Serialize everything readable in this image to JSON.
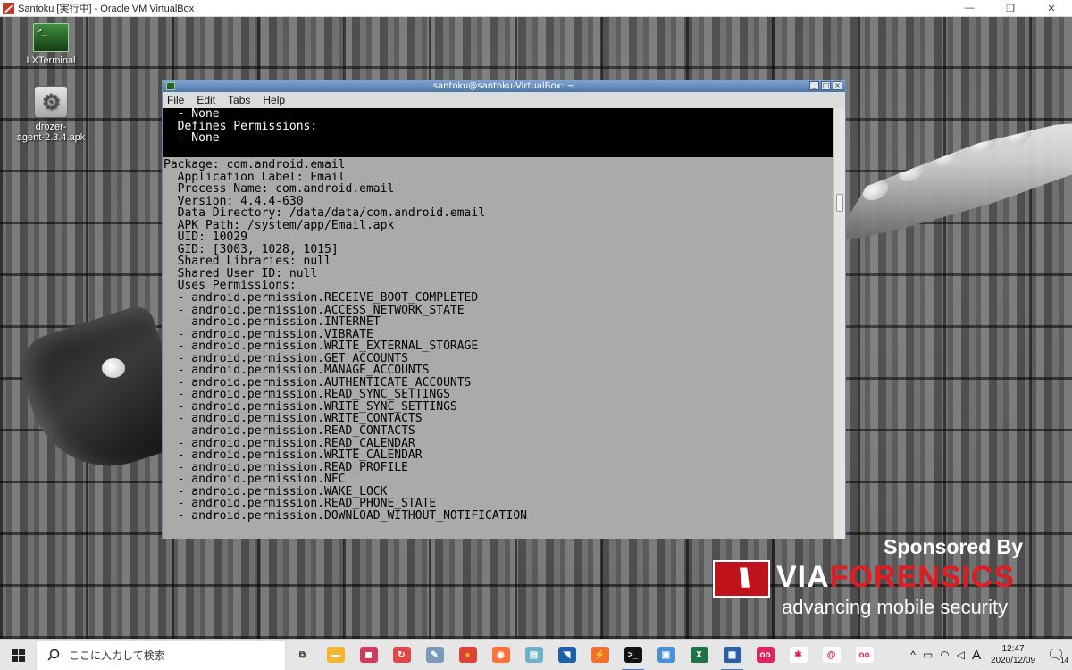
{
  "host_window": {
    "title": "Santoku [実行中] - Oracle VM VirtualBox",
    "minimize": "—",
    "restore": "❐",
    "close": "✕"
  },
  "desktop": {
    "icons": [
      {
        "label": "LXTerminal",
        "glyph": ">_"
      },
      {
        "label": "drozer-\nagent-2.3.4.apk",
        "glyph": "⚙"
      }
    ]
  },
  "terminal": {
    "title": "santoku@santoku-VirtualBox: ~",
    "menu": [
      "File",
      "Edit",
      "Tabs",
      "Help"
    ],
    "black_lines": [
      "  - None",
      "  Defines Permissions:",
      "  - None"
    ],
    "grey_lines": [
      "Package: com.android.email",
      "  Application Label: Email",
      "  Process Name: com.android.email",
      "  Version: 4.4.4-630",
      "  Data Directory: /data/data/com.android.email",
      "  APK Path: /system/app/Email.apk",
      "  UID: 10029",
      "  GID: [3003, 1028, 1015]",
      "  Shared Libraries: null",
      "  Shared User ID: null",
      "  Uses Permissions:",
      "  - android.permission.RECEIVE_BOOT_COMPLETED",
      "  - android.permission.ACCESS_NETWORK_STATE",
      "  - android.permission.INTERNET",
      "  - android.permission.VIBRATE",
      "  - android.permission.WRITE_EXTERNAL_STORAGE",
      "  - android.permission.GET_ACCOUNTS",
      "  - android.permission.MANAGE_ACCOUNTS",
      "  - android.permission.AUTHENTICATE_ACCOUNTS",
      "  - android.permission.READ_SYNC_SETTINGS",
      "  - android.permission.WRITE_SYNC_SETTINGS",
      "  - android.permission.WRITE_CONTACTS",
      "  - android.permission.READ_CONTACTS",
      "  - android.permission.READ_CALENDAR",
      "  - android.permission.WRITE_CALENDAR",
      "  - android.permission.READ_PROFILE",
      "  - android.permission.NFC",
      "  - android.permission.WAKE_LOCK",
      "  - android.permission.READ_PHONE_STATE",
      "  - android.permission.DOWNLOAD_WITHOUT_NOTIFICATION"
    ]
  },
  "sponsor": {
    "sponsored_by": "Sponsored By",
    "brand_via": "VIA",
    "brand_forensics": "FORENSICS",
    "tagline": "advancing mobile security"
  },
  "taskbar": {
    "search_placeholder": "ここに入力して検索",
    "apps": [
      {
        "name": "task-view",
        "glyph": "⧉",
        "color": "#e6e6e6",
        "fg": "#333"
      },
      {
        "name": "file-explorer",
        "glyph": "▬",
        "color": "#f2b632",
        "fg": "#fff"
      },
      {
        "name": "app-red",
        "glyph": "◼",
        "color": "#d13a5a",
        "fg": "#fff"
      },
      {
        "name": "app-sync",
        "glyph": "↻",
        "color": "#e04848",
        "fg": "#fff"
      },
      {
        "name": "app-feather",
        "glyph": "✎",
        "color": "#7a9ab8",
        "fg": "#fff"
      },
      {
        "name": "chrome",
        "glyph": "●",
        "color": "#db4437",
        "fg": "#fbbc05"
      },
      {
        "name": "firefox",
        "glyph": "◉",
        "color": "#ff7139",
        "fg": "#fff"
      },
      {
        "name": "app-notes",
        "glyph": "▤",
        "color": "#6fb1c9",
        "fg": "#fff"
      },
      {
        "name": "app-wireshark",
        "glyph": "◥",
        "color": "#1d5fa8",
        "fg": "#fff"
      },
      {
        "name": "app-burp",
        "glyph": "⚡",
        "color": "#f07030",
        "fg": "#fff"
      },
      {
        "name": "terminal",
        "glyph": ">_",
        "color": "#111111",
        "fg": "#fff"
      },
      {
        "name": "app-photos",
        "glyph": "▣",
        "color": "#4a90d9",
        "fg": "#fff"
      },
      {
        "name": "excel",
        "glyph": "X",
        "color": "#1f7244",
        "fg": "#fff"
      },
      {
        "name": "virtualbox",
        "glyph": "▦",
        "color": "#2e5fa0",
        "fg": "#fff"
      },
      {
        "name": "app-oo",
        "glyph": "oo",
        "color": "#e0245e",
        "fg": "#fff"
      },
      {
        "name": "slack",
        "glyph": "✱",
        "color": "#ffffff",
        "fg": "#e01e5a"
      },
      {
        "name": "app-debian",
        "glyph": "@",
        "color": "#ffffff",
        "fg": "#d70751"
      },
      {
        "name": "app-oo2",
        "glyph": "oo",
        "color": "#ffffff",
        "fg": "#e0245e"
      }
    ],
    "tray_chevron": "^",
    "ime": "A",
    "time": "12:47",
    "date": "2020/12/09",
    "notification_count": "14"
  }
}
